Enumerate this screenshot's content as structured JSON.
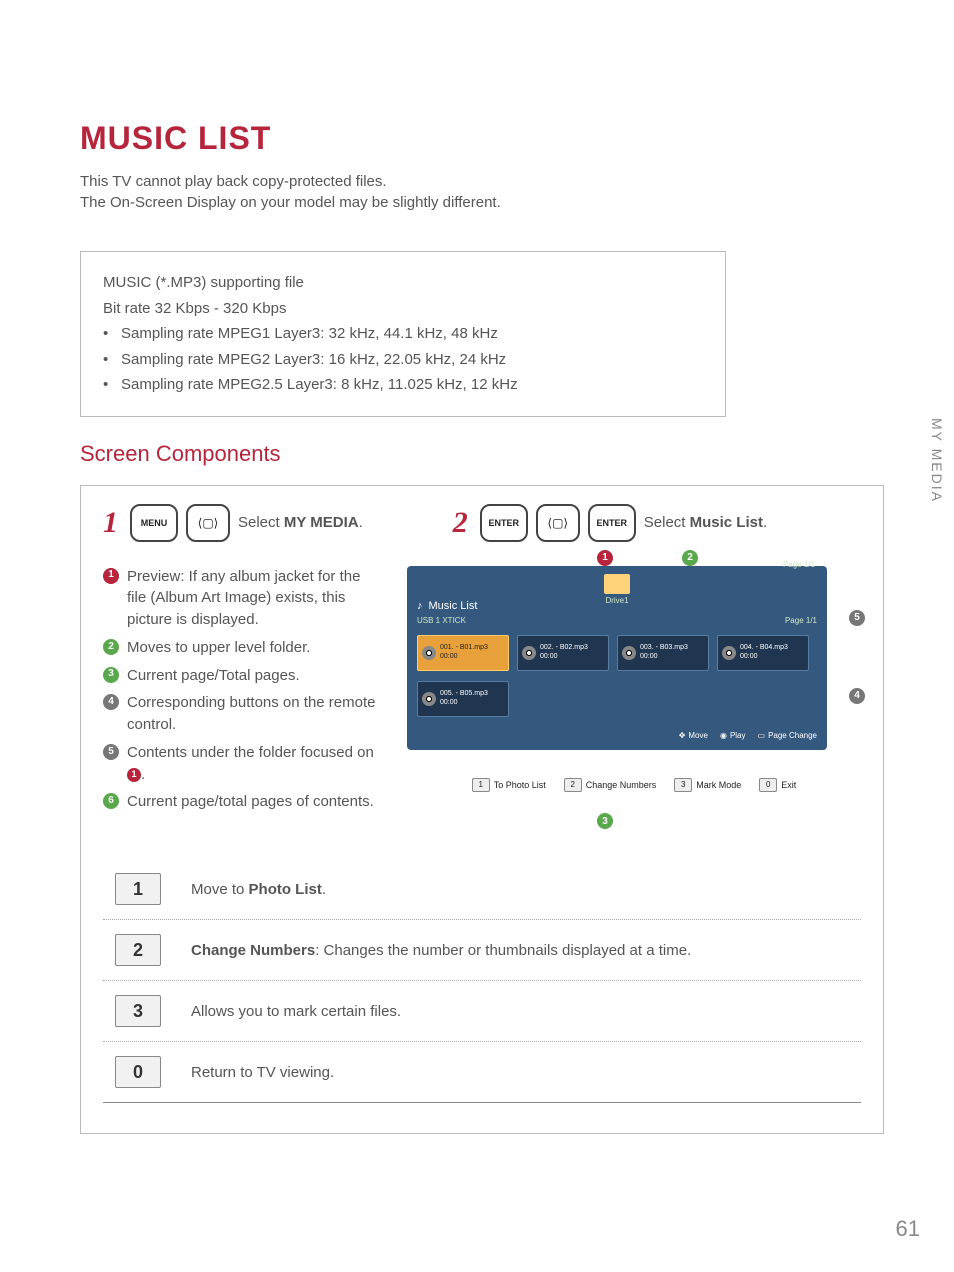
{
  "title": "MUSIC LIST",
  "intro": [
    "This TV cannot play back copy-protected files.",
    "The On-Screen Display on your model may be slightly different."
  ],
  "spec": {
    "line1": "MUSIC (*.MP3) supporting file",
    "line2": "Bit rate 32 Kbps - 320 Kbps",
    "bullets": [
      "Sampling rate MPEG1 Layer3: 32 kHz, 44.1 kHz, 48 kHz",
      "Sampling rate MPEG2 Layer3: 16 kHz, 22.05 kHz, 24 kHz",
      "Sampling rate MPEG2.5 Layer3: 8 kHz, 11.025 kHz, 12 kHz"
    ]
  },
  "section_title": "Screen Components",
  "steps": [
    {
      "num": "1",
      "key": "MENU",
      "text_pre": "Select ",
      "text_bold": "MY MEDIA",
      "text_post": "."
    },
    {
      "num": "2",
      "key": "ENTER",
      "key2": "ENTER",
      "text_pre": "Select ",
      "text_bold": "Music List",
      "text_post": "."
    }
  ],
  "legend": [
    "Preview: If any album jacket for the file (Album Art Image) exists, this picture is displayed.",
    "Moves to upper level folder.",
    "Current page/Total pages.",
    "Corresponding buttons on the remote control.",
    "Contents under the folder focused on ",
    "Current page/total pages of contents."
  ],
  "legend5_suffix": ".",
  "osd": {
    "title": "Music List",
    "sub": "USB 1 XTICK",
    "drive": "Drive1",
    "pagetop": "Page 1/1",
    "pageright": "Page 1/1",
    "tracks": [
      {
        "name": "001. - B01.mp3",
        "time": "00:00"
      },
      {
        "name": "002. - B02.mp3",
        "time": "00:00"
      },
      {
        "name": "003. - B03.mp3",
        "time": "00:00"
      },
      {
        "name": "004. - B04.mp3",
        "time": "00:00"
      },
      {
        "name": "005. - B05.mp3",
        "time": "00:00"
      }
    ],
    "foot": {
      "move": "Move",
      "play": "Play",
      "page": "Page Change"
    },
    "submenu": [
      {
        "k": "1",
        "t": "To Photo List"
      },
      {
        "k": "2",
        "t": "Change Numbers"
      },
      {
        "k": "3",
        "t": "Mark Mode"
      },
      {
        "k": "0",
        "t": "Exit"
      }
    ]
  },
  "keytable": [
    {
      "k": "1",
      "pre": "Move to ",
      "b": "Photo List",
      "post": "."
    },
    {
      "k": "2",
      "pre": "",
      "b": "Change Numbers",
      "post": ": Changes the number or thumbnails displayed at a time."
    },
    {
      "k": "3",
      "pre": "Allows you to mark certain files.",
      "b": "",
      "post": ""
    },
    {
      "k": "0",
      "pre": "Return to TV viewing.",
      "b": "",
      "post": ""
    }
  ],
  "sidetab": "MY MEDIA",
  "page": "61"
}
